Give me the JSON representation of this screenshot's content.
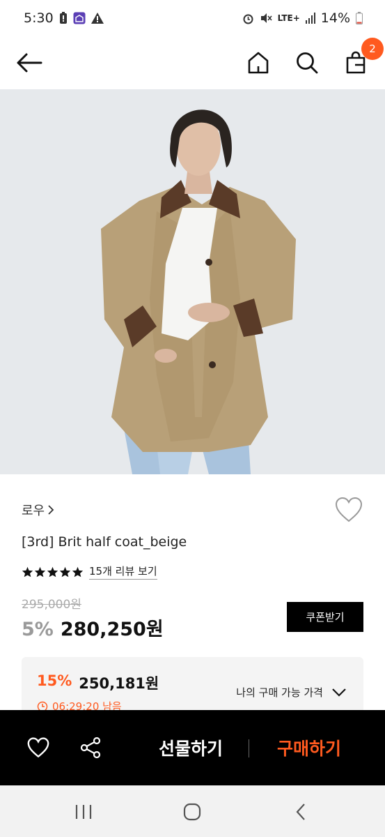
{
  "status_bar": {
    "time": "5:30",
    "network": "LTE+",
    "battery": "14%",
    "icons": [
      "battery-saver-icon",
      "school-app-icon",
      "warning-icon",
      "alarm-icon",
      "mute-icon",
      "signal-icon",
      "battery-icon"
    ]
  },
  "header": {
    "back_icon": "arrow-left-icon",
    "home_icon": "home-icon",
    "search_icon": "search-icon",
    "cart_icon": "shopping-bag-icon",
    "cart_count": "2"
  },
  "product": {
    "brand": "로우",
    "name": "[3rd] Brit half coat_beige",
    "rating_stars": 5,
    "review_text": "15개 리뷰 보기",
    "original_price": "295,000원",
    "discount": "5%",
    "price": "280,250원",
    "coupon_label": "쿠폰받기"
  },
  "promo": {
    "percent": "15%",
    "price": "250,181원",
    "timer": "06:29:20 남음",
    "toggle_label": "나의 구매 가능 가격"
  },
  "action_bar": {
    "gift_label": "선물하기",
    "buy_label": "구매하기"
  },
  "colors": {
    "accent": "#ff5a1f",
    "bar_bg": "#000000"
  }
}
